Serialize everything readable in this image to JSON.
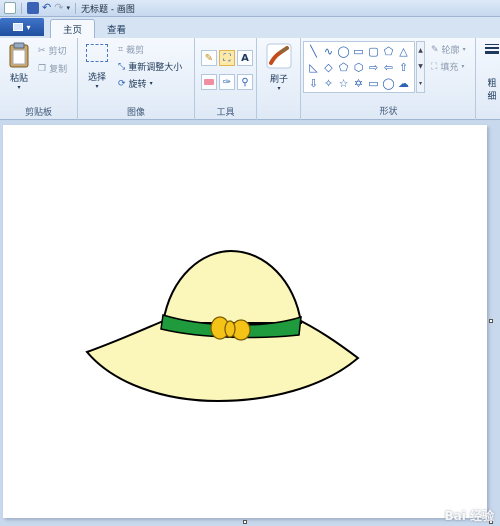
{
  "window": {
    "title": "无标题 - 画图"
  },
  "tabs": [
    {
      "label": "主页"
    },
    {
      "label": "查看"
    }
  ],
  "ribbon": {
    "clipboard": {
      "label": "剪贴板",
      "paste": "粘贴",
      "cut": "剪切",
      "copy": "复制"
    },
    "image": {
      "label": "图像",
      "select": "选择",
      "crop": "裁剪",
      "resize": "重新调整大小",
      "rotate": "旋转"
    },
    "tools": {
      "label": "工具"
    },
    "brushes": {
      "label": "刷子"
    },
    "shapes": {
      "label": "形状",
      "outline": "轮廓",
      "fill": "填充"
    },
    "size": {
      "label": "粗",
      "label2": "细"
    }
  },
  "canvas": {
    "hat_colors": {
      "crown": "#fbf6b9",
      "band": "#1f9a3c",
      "bow": "#f5c218",
      "outline": "#000000"
    }
  },
  "watermark": "Bai 经验"
}
